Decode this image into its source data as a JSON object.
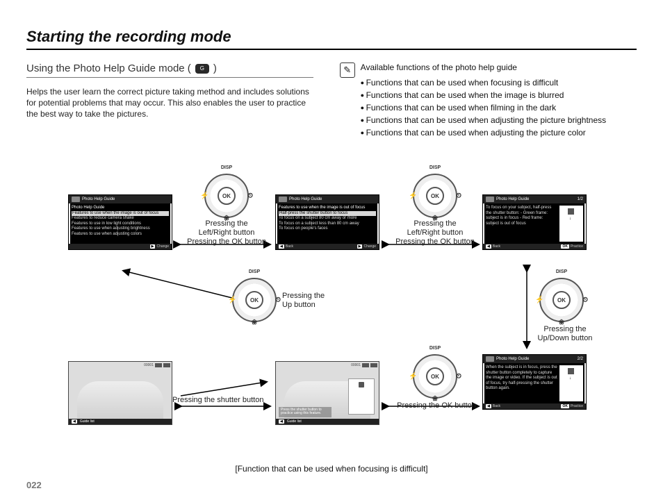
{
  "pageNumber": "022",
  "title": "Starting the recording mode",
  "subhead_prefix": "Using the Photo Help Guide mode (",
  "subhead_suffix": ")",
  "mode_icon_label": "G",
  "intro": "Helps the user learn the correct picture taking method and includes solutions for potential problems that may occur. This also enables the user to practice the best way to take the pictures.",
  "note_title": "Available functions of the photo help guide",
  "note_bullets": [
    "Functions that can be used when focusing is difficult",
    "Functions that can be used when the image is blurred",
    "Functions that can be used when filming in the dark",
    "Functions that can be used when adjusting the picture brightness",
    "Functions that can be used when adjusting the picture color"
  ],
  "dial": {
    "ok": "OK",
    "disp": "DISP",
    "flash": "⚡",
    "flower": "❀",
    "timer": "⏲"
  },
  "captions": {
    "lr_ok": "Pressing the\nLeft/Right button\nPressing the OK button",
    "up": "Pressing the\nUp button",
    "updown": "Pressing the\nUp/Down button",
    "shutter": "Pressing the shutter button",
    "ok": "Pressing the OK button",
    "footer": "[Function that can be used when focusing is difficult]"
  },
  "screens": {
    "s1": {
      "header": "Photo Help Guide",
      "sub": "Photo Help Guide",
      "items": [
        "Features to use when the image is out of focus",
        "Features to reduce camera shake",
        "Features to use in low light conditions",
        "Features to use when adjusting brightness",
        "Features to use when adjusting colors"
      ],
      "hl_index": 0,
      "foot_right": "Change"
    },
    "s2": {
      "header": "Photo Help Guide",
      "sub": "Features to use when the image is out of focus",
      "items": [
        "Half-press the shutter button to focus",
        "To focus on a subject 80 cm away or more",
        "To focus on a subject less than 80 cm away",
        "To focus on people's faces"
      ],
      "hl_index": 0,
      "foot_left": "Back",
      "foot_right": "Change"
    },
    "s3": {
      "header": "Photo Help Guide",
      "page": "1/2",
      "body": "To focus on your subject, half-press the shutter button:\n- Green frame: subject is in focus\n- Red frame: subject is out of focus",
      "foot_left": "Back",
      "foot_right": "Practice",
      "foot_right_key": "OK"
    },
    "s4": {
      "header": "Photo Help Guide",
      "page": "2/2",
      "body": "When the subject is in focus, press the shutter button completely to capture the image or video. If the subject is out of focus, try half-pressing the shutter button again.",
      "foot_left": "Back",
      "foot_right": "Practice",
      "foot_right_key": "OK"
    },
    "photo": {
      "counter": "00001",
      "foot1": "Guide list",
      "tip": "Press the shutter button to practice using this feature."
    }
  }
}
